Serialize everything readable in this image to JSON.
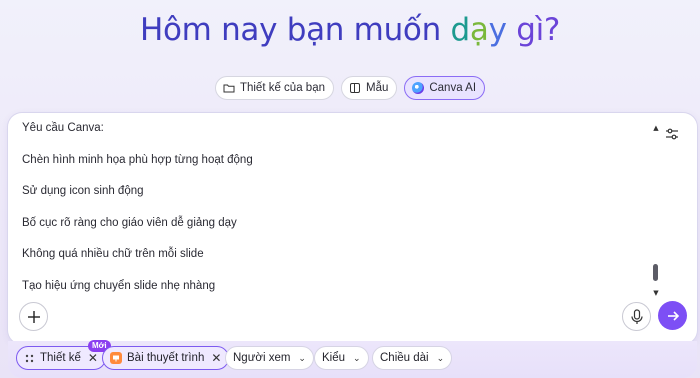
{
  "headline": {
    "main": "Hôm nay bạn muốn ",
    "d": "d",
    "a": "ạ",
    "y": "y",
    "rest": " gì?"
  },
  "modes": [
    {
      "label": "Thiết kế của bạn",
      "icon": "folder-icon",
      "active": false
    },
    {
      "label": "Mẫu",
      "icon": "template-icon",
      "active": false
    },
    {
      "label": "Canva AI",
      "icon": "canva-ai-icon",
      "active": true
    }
  ],
  "prompt": {
    "lines": [
      "Yêu cầu Canva:",
      "Chèn hình minh họa phù hợp từng hoạt động",
      "Sử dụng icon sinh động",
      "Bố cục rõ ràng cho giáo viên dễ giảng dạy",
      "Không quá nhiều chữ trên mỗi slide",
      "Tạo hiệu ứng chuyển slide nhẹ nhàng"
    ]
  },
  "chips": {
    "design": {
      "label": "Thiết kế",
      "badge": "Mới"
    },
    "presentation": {
      "label": "Bài thuyết trình"
    },
    "audience": {
      "label": "Người xem"
    },
    "style": {
      "label": "Kiểu"
    },
    "length": {
      "label": "Chiều dài"
    }
  },
  "colors": {
    "accent": "#7d4ff5",
    "headline": "#3f3dbf",
    "badge": "#8b3ff0"
  }
}
